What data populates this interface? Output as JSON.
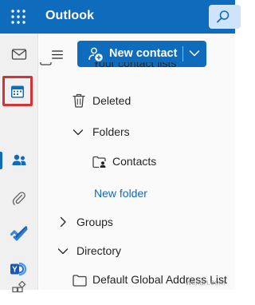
{
  "topbar": {
    "app_title": "Outlook",
    "waffle_icon": "app-launcher-icon",
    "search_icon": "search-icon",
    "bg_color": "#0f6cbd"
  },
  "rail": {
    "items": [
      {
        "name": "mail",
        "icon": "mail-icon"
      },
      {
        "name": "calendar",
        "icon": "calendar-icon",
        "highlighted": true
      },
      {
        "name": "people",
        "icon": "people-icon",
        "active": true
      },
      {
        "name": "files",
        "icon": "paperclip-icon"
      },
      {
        "name": "to-do",
        "icon": "todo-check-icon"
      },
      {
        "name": "yammer",
        "icon": "yammer-icon"
      },
      {
        "name": "apps",
        "icon": "apps-icon"
      }
    ],
    "highlight_color": "#d13438"
  },
  "toolbar": {
    "new_contact_label": "New contact"
  },
  "tree": {
    "your_contact_lists": "Your contact lists",
    "deleted": "Deleted",
    "folders": "Folders",
    "contacts": "Contacts",
    "new_folder": "New folder",
    "groups": "Groups",
    "directory": "Directory",
    "default_global_address_list": "Default Global Address List"
  },
  "watermark": "wsxdn.com"
}
